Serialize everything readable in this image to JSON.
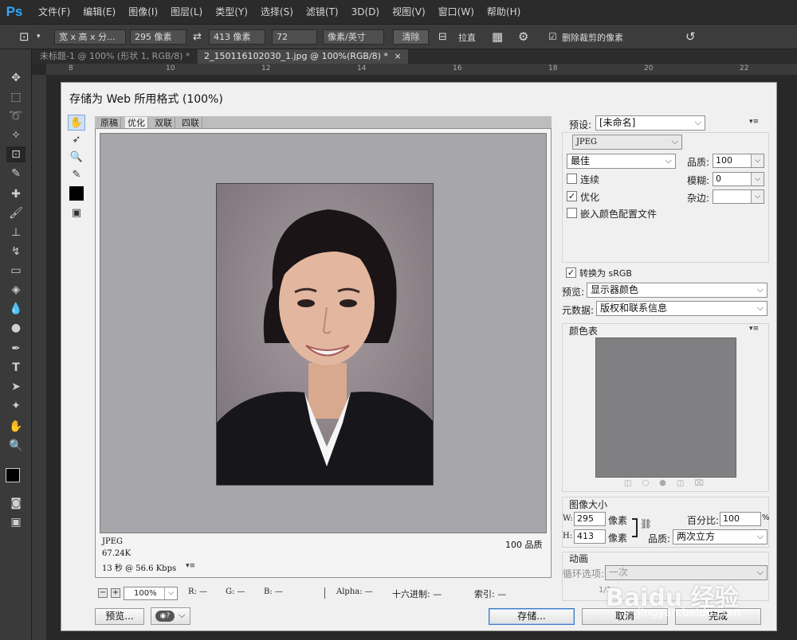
{
  "app": {
    "logo": "Ps",
    "menu": [
      "文件(F)",
      "编辑(E)",
      "图像(I)",
      "图层(L)",
      "类型(Y)",
      "选择(S)",
      "滤镜(T)",
      "3D(D)",
      "视图(V)",
      "窗口(W)",
      "帮助(H)"
    ]
  },
  "options": {
    "crop_icon": "crop-icon",
    "ratio_select": "宽 x 高 x 分...",
    "width": "295 像素",
    "height": "413 像素",
    "resolution": "72",
    "res_unit": "像素/英寸",
    "clear_label": "清除",
    "straighten_label": "拉直",
    "delete_cropped_label": "删除裁剪的像素"
  },
  "tabs": [
    {
      "label": "未标题-1 @ 100% (形状 1, RGB/8) *",
      "close": "×"
    },
    {
      "label": "2_150116102030_1.jpg @ 100%(RGB/8) *",
      "close": "×"
    }
  ],
  "ruler": [
    "8",
    "10",
    "12",
    "14",
    "16",
    "18",
    "20",
    "22"
  ],
  "dialog": {
    "title": "存储为 Web 所用格式 (100%)",
    "view_tabs": [
      "原稿",
      "优化",
      "双联",
      "四联"
    ],
    "info": {
      "format": "JPEG",
      "size": "67.24K",
      "time": "13 秒 @ 56.6 Kbps",
      "quality_text": "100 品质"
    },
    "bottom": {
      "zoom": "100%",
      "r": "R: —",
      "g": "G: —",
      "b": "B: —",
      "alpha": "Alpha: —",
      "hex": "十六进制: —",
      "index": "索引: —"
    },
    "buttons": {
      "preview": "预览...",
      "save": "存储...",
      "cancel": "取消",
      "done": "完成"
    },
    "settings": {
      "preset_label": "预设:",
      "preset_value": "[未命名]",
      "format": "JPEG",
      "quality_preset": "最佳",
      "quality_label": "品质:",
      "quality_value": "100",
      "blur_label": "模糊:",
      "blur_value": "0",
      "matte_label": "杂边:",
      "progressive_label": "连续",
      "progressive_checked": false,
      "optimized_label": "优化",
      "optimized_checked": true,
      "embed_profile_label": "嵌入颜色配置文件",
      "embed_profile_checked": false,
      "convert_srgb_label": "转换为 sRGB",
      "convert_srgb_checked": true,
      "preview_label": "预览:",
      "preview_value": "显示器颜色",
      "metadata_label": "元数据:",
      "metadata_value": "版权和联系信息"
    },
    "color_table": {
      "title": "颜色表",
      "swatch_color": "#808082"
    },
    "image_size": {
      "title": "图像大小",
      "w_label": "W:",
      "w_value": "295",
      "h_label": "H:",
      "h_value": "413",
      "unit": "像素",
      "percent_label": "百分比:",
      "percent_value": "100",
      "percent_unit": "%",
      "quality_label": "品质:",
      "quality_value": "两次立方"
    },
    "animation": {
      "title": "动画",
      "loop_label": "循环选项:",
      "loop_value": "一次",
      "frame": "1/1"
    }
  },
  "watermark": {
    "text": "Baidu 经验",
    "url": "jingyan.baidu.com"
  }
}
